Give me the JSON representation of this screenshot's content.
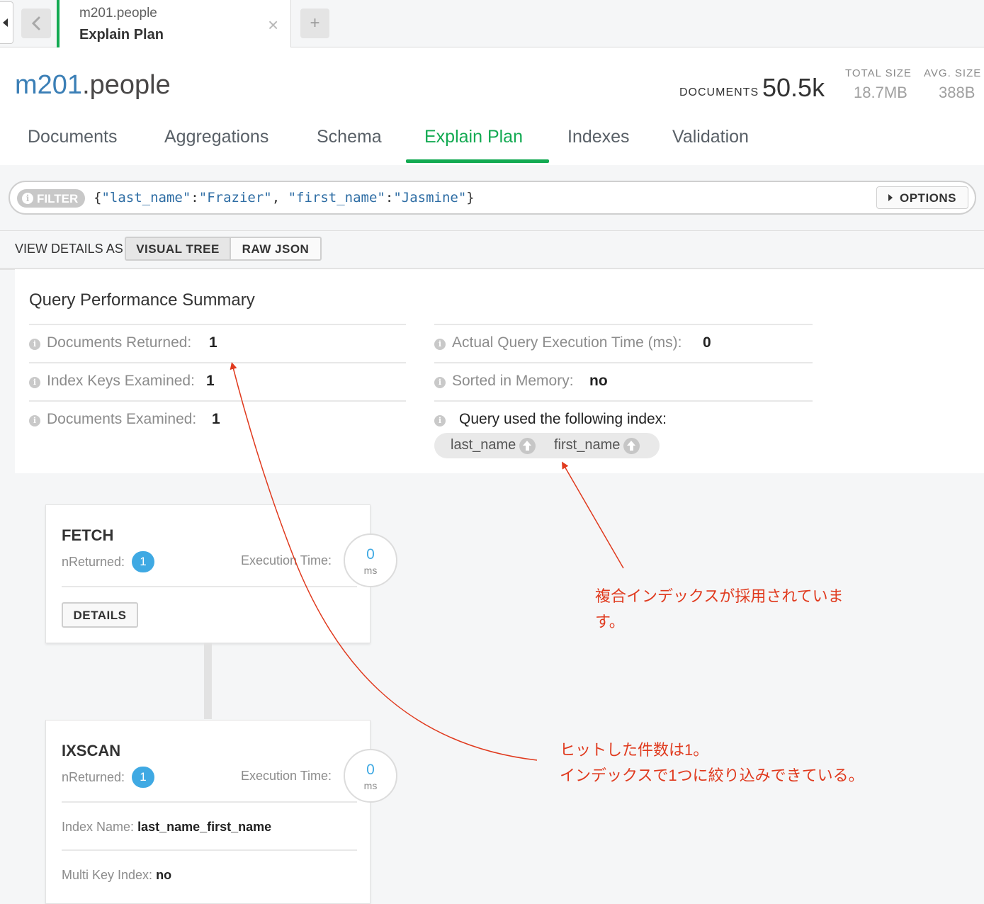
{
  "tabbar": {
    "tab_namespace": "m201.people",
    "tab_subtitle": "Explain Plan",
    "close_glyph": "×",
    "add_glyph": "+"
  },
  "header": {
    "db": "m201",
    "collection": ".people",
    "documents_label": "DOCUMENTS",
    "documents_value": "50.5k",
    "total_size_label": "TOTAL SIZE",
    "total_size_value": "18.7MB",
    "avg_size_label": "AVG. SIZE",
    "avg_size_value": "388B"
  },
  "tabs": [
    "Documents",
    "Aggregations",
    "Schema",
    "Explain Plan",
    "Indexes",
    "Validation"
  ],
  "filter": {
    "label": "FILTER",
    "open_brace": "{",
    "key1": "\"last_name\"",
    "val1": "\"Frazier\"",
    "key2": "\"first_name\"",
    "val2": "\"Jasmine\"",
    "close_brace": "}",
    "options_label": "OPTIONS"
  },
  "view": {
    "label": "VIEW DETAILS AS",
    "visual_tree": "VISUAL TREE",
    "raw_json": "RAW JSON"
  },
  "summary": {
    "title": "Query Performance Summary",
    "docs_returned_label": "Documents Returned:",
    "docs_returned": "1",
    "keys_examined_label": "Index Keys Examined:",
    "keys_examined": "1",
    "docs_examined_label": "Documents Examined:",
    "docs_examined": "1",
    "exec_time_label": "Actual Query Execution Time (ms):",
    "exec_time": "0",
    "sorted_label": "Sorted in Memory:",
    "sorted": "no",
    "index_label": "Query used the following index:",
    "index_fields": [
      "last_name",
      "first_name"
    ]
  },
  "stages": {
    "fetch": {
      "name": "FETCH",
      "nreturned_label": "nReturned:",
      "nreturned": "1",
      "exec_label": "Execution Time:",
      "exec_value": "0",
      "exec_unit": "ms",
      "details_label": "DETAILS"
    },
    "ixscan": {
      "name": "IXSCAN",
      "nreturned_label": "nReturned:",
      "nreturned": "1",
      "exec_label": "Execution Time:",
      "exec_value": "0",
      "exec_unit": "ms",
      "index_name_label": "Index Name:",
      "index_name": "last_name_first_name",
      "multikey_label": "Multi Key Index:",
      "multikey": "no"
    }
  },
  "annotations": {
    "note1_line1": "複合インデックスが採用されていま",
    "note1_line2": "す。",
    "note2_line1": "ヒットした件数は1。",
    "note2_line2": "インデックスで1つに絞り込みできている。",
    "color": "#e03a1e"
  },
  "colors": {
    "accent": "#13aa52",
    "link": "#3b7fb6",
    "badge": "#3fa9e3"
  }
}
